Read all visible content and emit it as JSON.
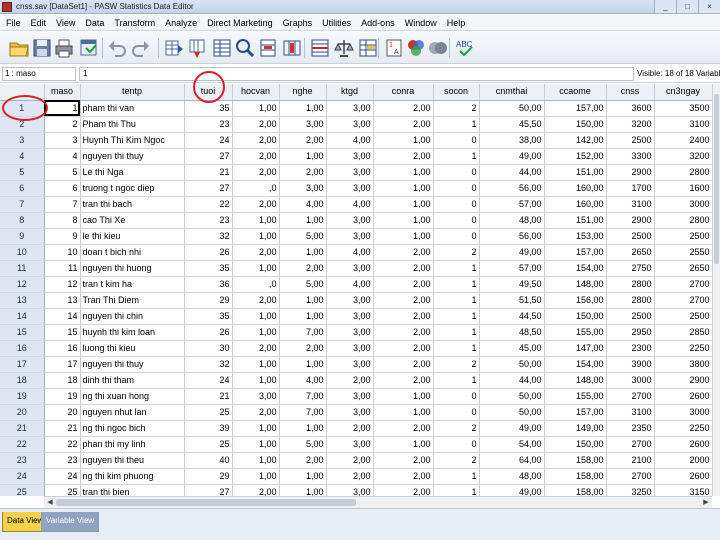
{
  "window": {
    "title": "cnss.sav [DataSet1] - PASW Statistics Data Editor",
    "controls": [
      "_",
      "□",
      "×"
    ]
  },
  "menu": [
    "File",
    "Edit",
    "View",
    "Data",
    "Transform",
    "Analyze",
    "Direct Marketing",
    "Graphs",
    "Utilities",
    "Add-ons",
    "Window",
    "Help"
  ],
  "toolbar_icons": [
    "open-folder-icon",
    "save-icon",
    "print-icon",
    "recall-dialog-icon",
    "undo-icon",
    "redo-icon",
    "go-to-case-icon",
    "go-to-variable-icon",
    "variables-icon",
    "find-icon",
    "insert-cases-icon",
    "insert-variable-icon",
    "split-file-icon",
    "weight-cases-icon",
    "select-cases-icon",
    "value-labels-icon",
    "use-variable-sets-icon",
    "show-all-variables-icon",
    "spell-check-icon"
  ],
  "cell_editor": {
    "reference": "1 : maso",
    "value": "1",
    "visible_count": "Visible: 18 of 18 Variables"
  },
  "columns": [
    "maso",
    "tentp",
    "tuoi",
    "hocvan",
    "nghe",
    "ktgd",
    "conra",
    "socon",
    "cnmthai",
    "ccaome",
    "cnss",
    "cn3ngay"
  ],
  "rows": [
    {
      "n": "1",
      "cells": [
        "1",
        "pham thi van",
        "35",
        "1,00",
        "1,00",
        "3,00",
        "2,00",
        "2",
        "50,00",
        "157,00",
        "3600",
        "3500"
      ]
    },
    {
      "n": "2",
      "cells": [
        "2",
        "Pham thi Thu",
        "23",
        "2,00",
        "3,00",
        "3,00",
        "2,00",
        "1",
        "45,50",
        "150,00",
        "3200",
        "3100"
      ]
    },
    {
      "n": "3",
      "cells": [
        "3",
        "Huynh Thi Kim Ngoc",
        "24",
        "2,00",
        "2,00",
        "4,00",
        "1,00",
        "0",
        "38,00",
        "142,00",
        "2500",
        "2400"
      ]
    },
    {
      "n": "4",
      "cells": [
        "4",
        "nguyen thi thuy",
        "27",
        "2,00",
        "1,00",
        "3,00",
        "2,00",
        "1",
        "49,00",
        "152,00",
        "3300",
        "3200"
      ]
    },
    {
      "n": "5",
      "cells": [
        "5",
        "Le thi Nga",
        "21",
        "2,00",
        "2,00",
        "3,00",
        "1,00",
        "0",
        "44,00",
        "151,00",
        "2900",
        "2800"
      ]
    },
    {
      "n": "6",
      "cells": [
        "6",
        "truong t ngoc diep",
        "27",
        ",0",
        "3,00",
        "3,00",
        "1,00",
        "0",
        "56,00",
        "160,00",
        "1700",
        "1600"
      ]
    },
    {
      "n": "7",
      "cells": [
        "7",
        "tran thi bach",
        "22",
        "2,00",
        "4,00",
        "4,00",
        "1,00",
        "0",
        "57,00",
        "160,00",
        "3100",
        "3000"
      ]
    },
    {
      "n": "8",
      "cells": [
        "8",
        "cao Thi Xe",
        "23",
        "1,00",
        "1,00",
        "3,00",
        "1,00",
        "0",
        "48,00",
        "151,00",
        "2900",
        "2800"
      ]
    },
    {
      "n": "9",
      "cells": [
        "9",
        "le thi kieu",
        "32",
        "1,00",
        "5,00",
        "3,00",
        "1,00",
        "0",
        "56,00",
        "153,00",
        "2500",
        "2500"
      ]
    },
    {
      "n": "10",
      "cells": [
        "10",
        "doan t bich nhi",
        "26",
        "2,00",
        "1,00",
        "4,00",
        "2,00",
        "2",
        "49,00",
        "157,00",
        "2650",
        "2550"
      ]
    },
    {
      "n": "11",
      "cells": [
        "11",
        "nguyen thi huong",
        "35",
        "1,00",
        "2,00",
        "3,00",
        "2,00",
        "1",
        "57,00",
        "154,00",
        "2750",
        "2650"
      ]
    },
    {
      "n": "12",
      "cells": [
        "12",
        "tran t kim ha",
        "36",
        ",0",
        "5,00",
        "4,00",
        "2,00",
        "1",
        "49,50",
        "148,00",
        "2800",
        "2700"
      ]
    },
    {
      "n": "13",
      "cells": [
        "13",
        "Tran Thi Diem",
        "29",
        "2,00",
        "1,00",
        "3,00",
        "2,00",
        "1",
        "51,50",
        "156,00",
        "2800",
        "2700"
      ]
    },
    {
      "n": "14",
      "cells": [
        "14",
        "nguyen thi chin",
        "35",
        "1,00",
        "1,00",
        "3,00",
        "2,00",
        "1",
        "44,50",
        "150,00",
        "2500",
        "2500"
      ]
    },
    {
      "n": "15",
      "cells": [
        "15",
        "huynh thi kim loan",
        "26",
        "1,00",
        "7,00",
        "3,00",
        "2,00",
        "1",
        "48,50",
        "155,00",
        "2950",
        "2850"
      ]
    },
    {
      "n": "16",
      "cells": [
        "16",
        "luong thi kieu",
        "30",
        "2,00",
        "2,00",
        "3,00",
        "2,00",
        "1",
        "45,00",
        "147,00",
        "2300",
        "2250"
      ]
    },
    {
      "n": "17",
      "cells": [
        "17",
        "nguyen thi thuy",
        "32",
        "1,00",
        "1,00",
        "3,00",
        "2,00",
        "2",
        "50,00",
        "154,00",
        "3900",
        "3800"
      ]
    },
    {
      "n": "18",
      "cells": [
        "18",
        "dinh thi tham",
        "24",
        "1,00",
        "4,00",
        "2,00",
        "2,00",
        "1",
        "44,00",
        "148,00",
        "3000",
        "2900"
      ]
    },
    {
      "n": "19",
      "cells": [
        "19",
        "ng thi xuan hong",
        "21",
        "3,00",
        "7,00",
        "3,00",
        "1,00",
        "0",
        "50,00",
        "155,00",
        "2700",
        "2600"
      ]
    },
    {
      "n": "20",
      "cells": [
        "20",
        "nguyen nhut lan",
        "25",
        "2,00",
        "7,00",
        "3,00",
        "1,00",
        "0",
        "50,00",
        "157,00",
        "3100",
        "3000"
      ]
    },
    {
      "n": "21",
      "cells": [
        "21",
        "ng thi ngoc bich",
        "39",
        "1,00",
        "1,00",
        "2,00",
        "2,00",
        "2",
        "49,00",
        "149,00",
        "2350",
        "2250"
      ]
    },
    {
      "n": "22",
      "cells": [
        "22",
        "phan thi my linh",
        "25",
        "1,00",
        "5,00",
        "3,00",
        "1,00",
        "0",
        "54,00",
        "150,00",
        "2700",
        "2600"
      ]
    },
    {
      "n": "23",
      "cells": [
        "23",
        "nguyen thi theu",
        "40",
        "1,00",
        "2,00",
        "2,00",
        "2,00",
        "2",
        "64,00",
        "158,00",
        "2100",
        "2000"
      ]
    },
    {
      "n": "24",
      "cells": [
        "24",
        "ng thi kim phuong",
        "29",
        "1,00",
        "1,00",
        "2,00",
        "2,00",
        "1",
        "48,00",
        "158,00",
        "2700",
        "2600"
      ]
    },
    {
      "n": "25",
      "cells": [
        "25",
        "tran thi bien",
        "27",
        "2,00",
        "1,00",
        "3,00",
        "2,00",
        "1",
        "49,00",
        "158,00",
        "3250",
        "3150"
      ]
    }
  ],
  "view_tabs": {
    "data_view": "Data View",
    "variable_view": "Variable View"
  }
}
